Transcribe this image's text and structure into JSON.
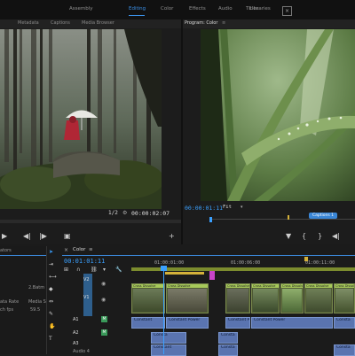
{
  "workspaces": {
    "items": [
      "Assembly",
      "Editing",
      "Color",
      "Effects",
      "Audio",
      "Titles",
      "Libraries"
    ],
    "active": "Editing",
    "close_glyph": "×"
  },
  "source_panel": {
    "tabs": [
      "Metadata",
      "Captions",
      "Media Browser"
    ],
    "zoom": "1/2",
    "timecode": "00:00:02:07"
  },
  "program_panel": {
    "title": "Program: Color",
    "menu": "≡",
    "timecode": "00:00:01:11",
    "fit": "Fit",
    "caption_tag": "Captions 1"
  },
  "project_panel": {
    "title": "ators",
    "rows": [
      {
        "name": "",
        "value": "2.Batm"
      },
      {
        "name": "ata Rate",
        "value": "Media S"
      },
      {
        "name": "ch fps",
        "value": "59.5"
      }
    ]
  },
  "timeline": {
    "tab": "Color",
    "menu": "≡",
    "timecode": "00:01:01:11",
    "ruler": [
      "01:00:01:00",
      "01:00:06:00",
      "01:00:11:00"
    ],
    "tracks": [
      {
        "id": "V2",
        "name": ""
      },
      {
        "id": "V1",
        "name": ""
      },
      {
        "id": "A1",
        "name": ""
      },
      {
        "id": "A2",
        "name": ""
      },
      {
        "id": "A3",
        "name": ""
      },
      {
        "id": "A4",
        "name": "Audio 4"
      }
    ],
    "audio_clips": [
      {
        "label": "Constant",
        "row": 0
      },
      {
        "label": "Constant Power",
        "row": 0
      },
      {
        "label": "Constant Power",
        "row": 0
      },
      {
        "label": "Constant Power",
        "row": 0
      },
      {
        "label": "Consta",
        "row": 0
      },
      {
        "label": "Consta",
        "row": 1
      },
      {
        "label": "Consta",
        "row": 1
      },
      {
        "label": "Constant",
        "row": 2
      },
      {
        "label": "Consta",
        "row": 2
      },
      {
        "label": "Consta",
        "row": 2
      }
    ],
    "video_clip_label": "Cross Dissolve"
  },
  "icons": [
    "play-icon",
    "step-back-icon",
    "step-forward-icon",
    "export-frame-icon",
    "add-icon",
    "marker-icon",
    "wrench-icon",
    "magnet-icon"
  ]
}
